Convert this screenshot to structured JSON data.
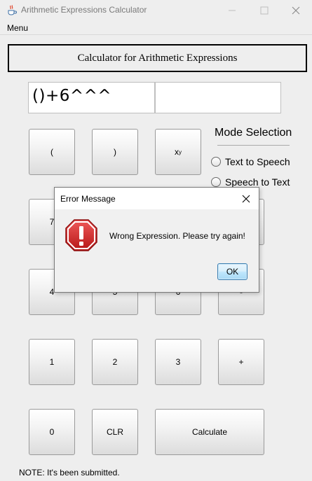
{
  "window": {
    "title": "Arithmetic Expressions Calculator",
    "icon": "java-cup-icon",
    "controls": [
      "minimize-icon",
      "maximize-icon",
      "close-icon"
    ]
  },
  "menubar": {
    "menu_label": "Menu"
  },
  "header": {
    "title": "Calculator for Arithmetic Expressions"
  },
  "display": {
    "expression": "()+6^^^",
    "result": ""
  },
  "keypad": {
    "open_paren": "(",
    "close_paren": ")",
    "power_base": "x",
    "power_exp": "y",
    "seven": "7",
    "four": "4",
    "five": "5",
    "six": "6",
    "minus": "-",
    "one": "1",
    "two": "2",
    "three": "3",
    "plus": "+",
    "zero": "0",
    "clear": "CLR",
    "calculate": "Calculate"
  },
  "mode": {
    "title": "Mode Selection",
    "options": [
      "Text to Speech",
      "Speech to Text"
    ],
    "selected": null
  },
  "note": "NOTE: It's been submitted.",
  "dialog": {
    "title": "Error Message",
    "message": "Wrong Expression. Please try again!",
    "ok_label": "OK",
    "icon": "error-octagon-icon",
    "icon_color": "#d42a2a"
  }
}
